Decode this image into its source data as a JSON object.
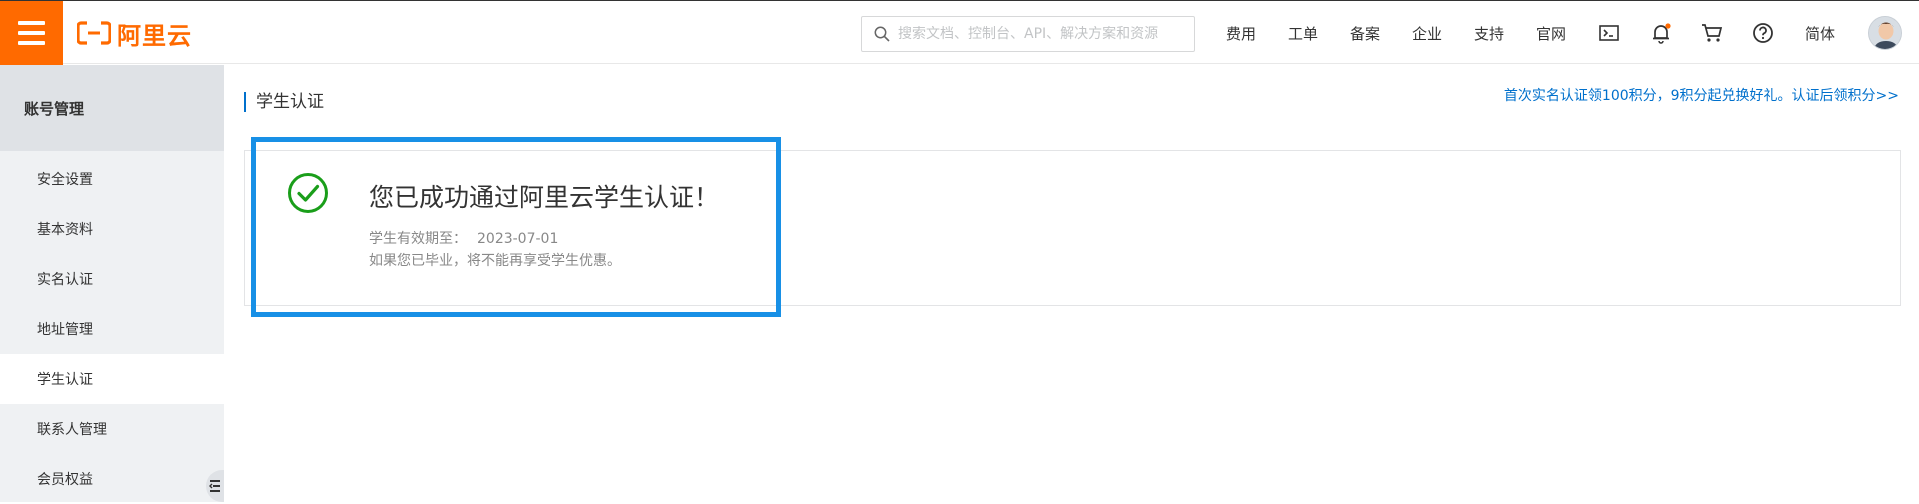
{
  "header": {
    "logo_text": "阿里云",
    "search_placeholder": "搜索文档、控制台、API、解决方案和资源",
    "nav": {
      "fees": "费用",
      "tickets": "工单",
      "filing": "备案",
      "enterprise": "企业",
      "support": "支持",
      "official_site": "官网",
      "language": "简体"
    },
    "icons": [
      "terminal-icon",
      "bell-icon",
      "cart-icon",
      "help-icon"
    ],
    "accent_color": "#ff6a00"
  },
  "sidebar": {
    "heading": "账号管理",
    "items": [
      {
        "label": "安全设置"
      },
      {
        "label": "基本资料"
      },
      {
        "label": "实名认证"
      },
      {
        "label": "地址管理"
      },
      {
        "label": "学生认证",
        "active": true
      },
      {
        "label": "联系人管理"
      },
      {
        "label": "会员权益"
      }
    ]
  },
  "main": {
    "title": "学生认证",
    "promo_link": "首次实名认证领100积分，9积分起兑换好礼。认证后领积分>>",
    "success": {
      "title": "您已成功通过阿里云学生认证！",
      "valid_label": "学生有效期至：",
      "valid_date": "2023-07-01",
      "note": "如果您已毕业，将不能再享受学生优惠。"
    },
    "link_color": "#0070cc",
    "success_color": "#1a9e1a",
    "highlight_color": "#1890e6"
  }
}
